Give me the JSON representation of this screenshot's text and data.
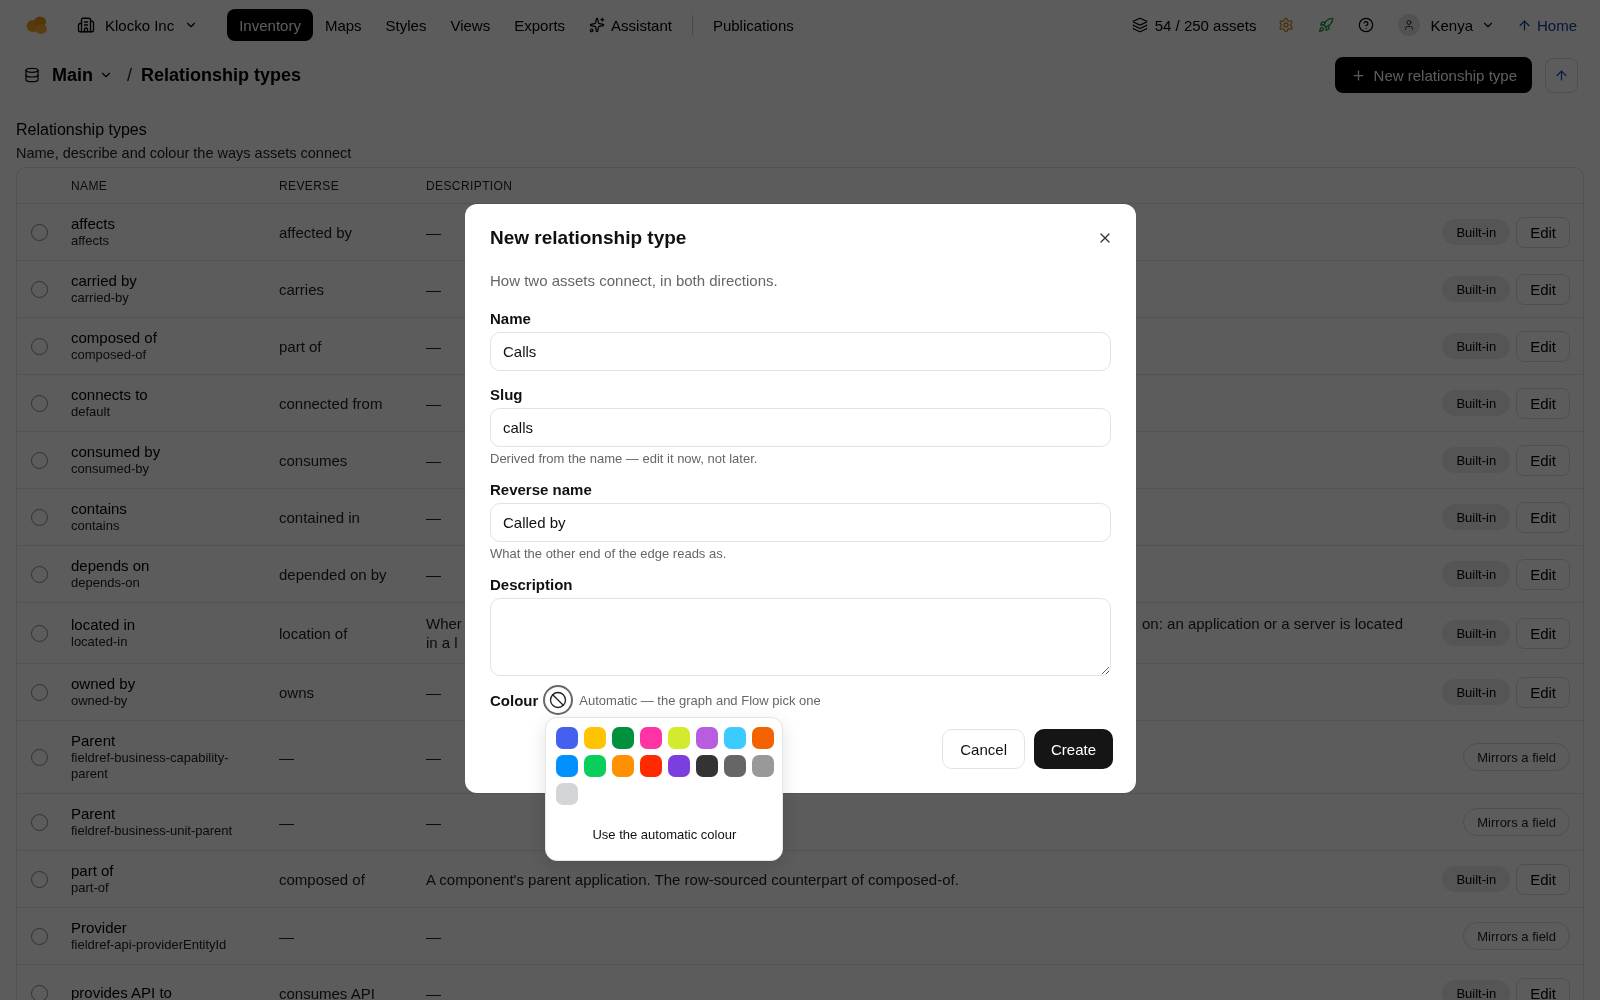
{
  "top_bar": {
    "workspace": "Klocko Inc",
    "nav": [
      {
        "label": "Inventory",
        "selected": true,
        "kind": "plain"
      },
      {
        "label": "Maps",
        "selected": false,
        "kind": "plain"
      },
      {
        "label": "Styles",
        "selected": false,
        "kind": "plain"
      },
      {
        "label": "Views",
        "selected": false,
        "kind": "plain"
      },
      {
        "label": "Exports",
        "selected": false,
        "kind": "plain"
      },
      {
        "label": "Assistant",
        "selected": false,
        "kind": "assistant"
      }
    ],
    "nav_secondary": [
      {
        "label": "Publications",
        "selected": false,
        "kind": "plain"
      }
    ],
    "usage": "54 / 250 assets",
    "user": "Kenya",
    "home": "Home"
  },
  "breadcrumb": {
    "root": "Main",
    "separator": "/",
    "current": "Relationship types",
    "new_button": "New relationship type"
  },
  "section": {
    "title": "Relationship types",
    "subtitle": "Name, describe and colour the ways assets connect"
  },
  "table": {
    "columns": [
      "NAME",
      "REVERSE",
      "DESCRIPTION"
    ],
    "rows": [
      {
        "name": "affects",
        "slug": "affects",
        "reverse": "affected by",
        "description": "—",
        "checked": false,
        "kind": "built_in",
        "badge": "Built-in",
        "edit": "Edit"
      },
      {
        "name": "carried by",
        "slug": "carried-by",
        "reverse": "carries",
        "description": "—",
        "checked": false,
        "kind": "built_in",
        "badge": "Built-in",
        "edit": "Edit"
      },
      {
        "name": "composed of",
        "slug": "composed-of",
        "reverse": "part of",
        "description": "—",
        "checked": false,
        "kind": "built_in",
        "badge": "Built-in",
        "edit": "Edit"
      },
      {
        "name": "connects to",
        "slug": "default",
        "reverse": "connected from",
        "description": "—",
        "checked": false,
        "kind": "built_in",
        "badge": "Built-in",
        "edit": "Edit"
      },
      {
        "name": "consumed by",
        "slug": "consumed-by",
        "reverse": "consumes",
        "description": "—",
        "checked": false,
        "kind": "built_in",
        "badge": "Built-in",
        "edit": "Edit"
      },
      {
        "name": "contains",
        "slug": "contains",
        "reverse": "contained in",
        "description": "—",
        "checked": false,
        "kind": "built_in",
        "badge": "Built-in",
        "edit": "Edit"
      },
      {
        "name": "depends on",
        "slug": "depends-on",
        "reverse": "depended on by",
        "description": "—",
        "checked": false,
        "kind": "built_in",
        "badge": "Built-in",
        "edit": "Edit"
      },
      {
        "name": "located in",
        "slug": "located-in",
        "reverse": "location of",
        "description_parts": {
          "left": [
            "Wher",
            "in a l"
          ],
          "right": "on: an application or a server is located"
        },
        "checked": false,
        "kind": "built_in",
        "badge": "Built-in",
        "edit": "Edit"
      },
      {
        "name": "owned by",
        "slug": "owned-by",
        "reverse": "owns",
        "description": "—",
        "checked": false,
        "kind": "built_in",
        "badge": "Built-in",
        "edit": "Edit"
      },
      {
        "name": "Parent",
        "slug": "fieldref-business-capability-parent",
        "reverse": "—",
        "description": "—",
        "checked": false,
        "kind": "field_mirror",
        "badge": "Mirrors a field"
      },
      {
        "name": "Parent",
        "slug": "fieldref-business-unit-parent",
        "reverse": "—",
        "description": "—",
        "checked": false,
        "kind": "field_mirror",
        "badge": "Mirrors a field"
      },
      {
        "name": "part of",
        "slug": "part-of",
        "reverse": "composed of",
        "description": "A component's parent application. The row-sourced counterpart of composed-of.",
        "checked": false,
        "kind": "built_in",
        "badge": "Built-in",
        "edit": "Edit"
      },
      {
        "name": "Provider",
        "slug": "fieldref-api-providerEntityId",
        "reverse": "—",
        "description": "—",
        "checked": false,
        "kind": "field_mirror",
        "badge": "Mirrors a field"
      },
      {
        "name": "provides API to",
        "reverse": "consumes API",
        "description": "—",
        "checked": false,
        "kind": "built_in",
        "badge": "Built-in",
        "edit": "Edit"
      }
    ]
  },
  "dialog": {
    "title": "New relationship type",
    "subtitle": "How two assets connect, in both directions.",
    "fields": [
      {
        "label": "Name",
        "value": "Calls",
        "kind": "input"
      },
      {
        "label": "Slug",
        "value": "calls",
        "hint": "Derived from the name — edit it now, not later.",
        "kind": "input"
      },
      {
        "label": "Reverse name",
        "value": "Called by",
        "hint": "What the other end of the edge reads as.",
        "kind": "input"
      },
      {
        "label": "Description",
        "kind": "textarea"
      }
    ],
    "colour": {
      "label": "Colour",
      "hint": "Automatic — the graph and Flow pick one",
      "open": true,
      "swatches": [
        {
          "color": "#4361ee",
          "selected": false
        },
        {
          "color": "#ffc300",
          "selected": false
        },
        {
          "color": "#00913f",
          "selected": false
        },
        {
          "color": "#ff33a3",
          "selected": false
        },
        {
          "color": "#d4ea2e",
          "selected": false
        },
        {
          "color": "#b85ce0",
          "selected": false
        },
        {
          "color": "#3ccbff",
          "selected": false
        },
        {
          "color": "#f46200",
          "selected": false
        },
        {
          "color": "#0090ff",
          "selected": false
        },
        {
          "color": "#0ace5c",
          "selected": false
        },
        {
          "color": "#ff9000",
          "selected": false
        },
        {
          "color": "#ff2a00",
          "selected": false
        },
        {
          "color": "#7b3fe0",
          "selected": false
        },
        {
          "color": "#333333",
          "selected": false
        },
        {
          "color": "#666666",
          "selected": false
        },
        {
          "color": "#999999",
          "selected": false
        },
        {
          "color": "#d4d5d7",
          "selected": false
        }
      ],
      "automatic_option": "Use the automatic colour"
    },
    "cancel": "Cancel",
    "create": "Create"
  }
}
